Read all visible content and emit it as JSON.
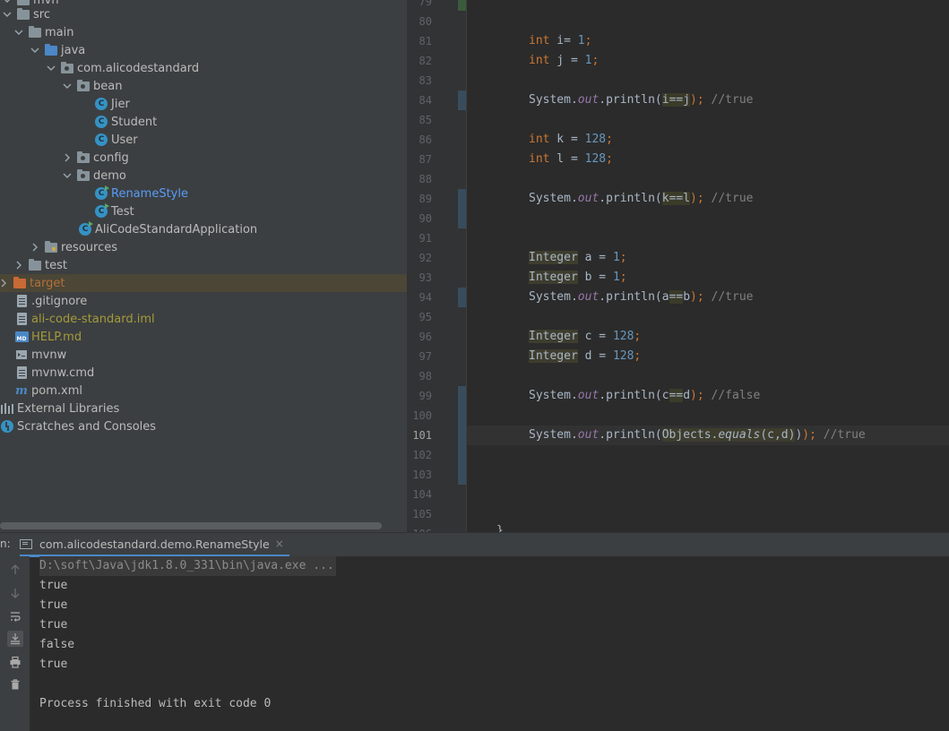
{
  "tree": {
    "items": [
      {
        "label": "...",
        "kind": "folder",
        "depth": 0,
        "expanded": true,
        "y": -4
      },
      {
        "label": "src",
        "kind": "folder"
      },
      {
        "label": "main",
        "kind": "folder"
      },
      {
        "label": "java",
        "kind": "folder-blue"
      },
      {
        "label": "com.alicodestandard",
        "kind": "package"
      },
      {
        "label": "bean",
        "kind": "package"
      },
      {
        "label": "Jier",
        "kind": "class"
      },
      {
        "label": "Student",
        "kind": "class"
      },
      {
        "label": "User",
        "kind": "class"
      },
      {
        "label": "config",
        "kind": "package"
      },
      {
        "label": "demo",
        "kind": "package"
      },
      {
        "label": "RenameStyle",
        "kind": "class-run"
      },
      {
        "label": "Test",
        "kind": "class-run"
      },
      {
        "label": "AliCodeStandardApplication",
        "kind": "spring-class"
      },
      {
        "label": "resources",
        "kind": "resources"
      },
      {
        "label": "test",
        "kind": "folder"
      },
      {
        "label": "target",
        "kind": "folder-orange"
      },
      {
        "label": ".gitignore",
        "kind": "file"
      },
      {
        "label": "ali-code-standard.iml",
        "kind": "file"
      },
      {
        "label": "HELP.md",
        "kind": "md"
      },
      {
        "label": "mvnw",
        "kind": "mvnw"
      },
      {
        "label": "mvnw.cmd",
        "kind": "file"
      },
      {
        "label": "pom.xml",
        "kind": "pom"
      },
      {
        "label": "External Libraries",
        "kind": "lib"
      },
      {
        "label": "Scratches and Consoles",
        "kind": "scratch"
      }
    ],
    "top_cut_label": "mvn"
  },
  "editor": {
    "line_numbers": [
      "79",
      "80",
      "81",
      "82",
      "83",
      "84",
      "85",
      "86",
      "87",
      "88",
      "89",
      "90",
      "91",
      "92",
      "93",
      "94",
      "95",
      "96",
      "97",
      "98",
      "99",
      "100",
      "101",
      "102",
      "103",
      "104",
      "105",
      "106"
    ],
    "current_line": "101",
    "code": {
      "l81": {
        "kw": "int",
        "rest": " i= ",
        "num": "1",
        "end": ";"
      },
      "l82": {
        "kw": "int",
        "rest": " j = ",
        "num": "1",
        "end": ";"
      },
      "l84": {
        "pre": "System.",
        "fld": "out",
        "mid": ".println(",
        "a": "i",
        "op": "==",
        "b": "j",
        "post": ");",
        "cm": " //true"
      },
      "l86": {
        "kw": "int",
        "rest": " k = ",
        "num": "128",
        "end": ";"
      },
      "l87": {
        "kw": "int",
        "rest": " l = ",
        "num": "128",
        "end": ";"
      },
      "l89": {
        "pre": "System.",
        "fld": "out",
        "mid": ".println(",
        "a": "k",
        "op": "==",
        "b": "l",
        "post": ");",
        "cm": " //true"
      },
      "l92": {
        "type": "Integer",
        "rest": " a = ",
        "num": "1",
        "end": ";"
      },
      "l93": {
        "type": "Integer",
        "rest": " b = ",
        "num": "1",
        "end": ";"
      },
      "l94": {
        "pre": "System.",
        "fld": "out",
        "mid": ".println(",
        "a": "a",
        "op": "==",
        "b": "b",
        "post": ");",
        "cm": " //true"
      },
      "l96": {
        "type": "Integer",
        "rest": " c = ",
        "num": "128",
        "end": ";"
      },
      "l97": {
        "type": "Integer",
        "rest": " d = ",
        "num": "128",
        "end": ";"
      },
      "l99": {
        "pre": "System.",
        "fld": "out",
        "mid": ".println(",
        "a": "c",
        "op": "==",
        "b": "d",
        "post": ");",
        "cm": " //false"
      },
      "l101": {
        "pre": "System.",
        "fld": "out",
        "mid": ".println(",
        "obj": "Objects",
        "dot": ".",
        "meth": "equals",
        "args": "(c,d)",
        "close": ")",
        "post": ");",
        "cm": " //true"
      },
      "l106": {
        "brace": "}"
      }
    }
  },
  "run": {
    "prefix": "n:",
    "tab_label": "com.alicodestandard.demo.RenameStyle",
    "tab_close": "×",
    "output": [
      "D:\\soft\\Java\\jdk1.8.0_331\\bin\\java.exe ...",
      "true",
      "true",
      "true",
      "false",
      "true",
      "",
      "Process finished with exit code 0"
    ]
  }
}
